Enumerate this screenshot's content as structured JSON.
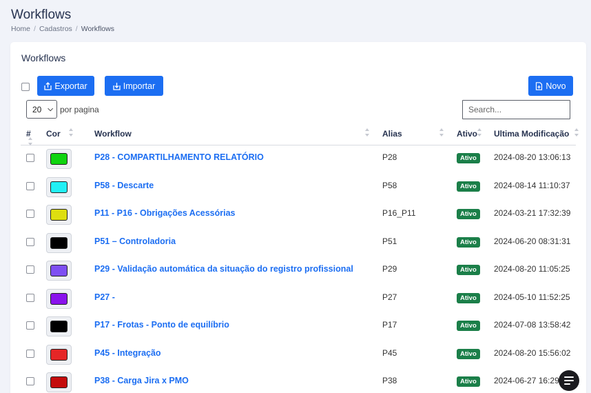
{
  "page": {
    "title": "Workflows",
    "breadcrumb": [
      "Home",
      "Cadastros",
      "Workflows"
    ]
  },
  "card": {
    "title": "Workflows",
    "buttons": {
      "export": "Exportar",
      "import": "Importar",
      "new": "Novo"
    },
    "per_page_value": "20",
    "per_page_label": "por pagina",
    "search_placeholder": "Search..."
  },
  "table": {
    "columns": [
      "#",
      "Cor",
      "Workflow",
      "Alias",
      "Ativo",
      "Ultima Modificação"
    ],
    "rows": [
      {
        "color": "#0fd40f",
        "name": "P28 - COMPARTILHAMENTO RELATÓRIO",
        "alias": "P28",
        "status": "Ativo",
        "modified": "2024-08-20 13:06:13"
      },
      {
        "color": "#22f0f5",
        "name": "P58 - Descarte",
        "alias": "P58",
        "status": "Ativo",
        "modified": "2024-08-14 11:10:37"
      },
      {
        "color": "#dede10",
        "name": "P11 - P16 - Obrigações Acessórias",
        "alias": "P16_P11",
        "status": "Ativo",
        "modified": "2024-03-21 17:32:39"
      },
      {
        "color": "#000000",
        "name": "P51 – Controladoria",
        "alias": "P51",
        "status": "Ativo",
        "modified": "2024-06-20 08:31:31"
      },
      {
        "color": "#7e4ff2",
        "name": "P29 - Validação automática da situação do registro profissional",
        "alias": "P29",
        "status": "Ativo",
        "modified": "2024-08-20 11:05:25"
      },
      {
        "color": "#8a12ec",
        "name": "P27 -",
        "alias": "P27",
        "status": "Ativo",
        "modified": "2024-05-10 11:52:25"
      },
      {
        "color": "#000000",
        "name": "P17 - Frotas - Ponto de equilíbrio",
        "alias": "P17",
        "status": "Ativo",
        "modified": "2024-07-08 13:58:42"
      },
      {
        "color": "#e52626",
        "name": "P45 - Integração",
        "alias": "P45",
        "status": "Ativo",
        "modified": "2024-08-20 15:56:02"
      },
      {
        "color": "#c40c0c",
        "name": "P38 - Carga Jira x PMO",
        "alias": "P38",
        "status": "Ativo",
        "modified": "2024-06-27 16:29:15"
      }
    ]
  },
  "icons": {
    "export": "upload-icon",
    "import": "download-icon",
    "new": "file-plus-icon",
    "chat": "chat-icon"
  }
}
